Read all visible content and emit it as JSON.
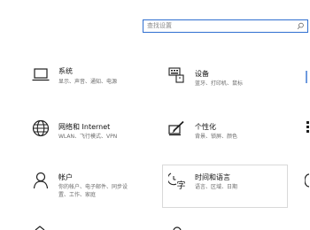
{
  "search": {
    "placeholder": "查找设置"
  },
  "categories": [
    {
      "title": "系统",
      "desc": "显示、声音、通知、电源",
      "icon": "laptop-icon"
    },
    {
      "title": "设备",
      "desc": "蓝牙、打印机、鼠标",
      "icon": "keyboard-icon"
    },
    {
      "title": "网络和 Internet",
      "desc": "WLAN、飞行模式、VPN",
      "icon": "globe-icon"
    },
    {
      "title": "个性化",
      "desc": "背景、锁屏、颜色",
      "icon": "paint-pen-icon"
    },
    {
      "title": "帐户",
      "desc_line1": "你的帐户、电子邮件、同步设",
      "desc_line2": "置、工作、家庭",
      "icon": "person-icon"
    },
    {
      "title": "时间和语言",
      "desc": "语言、区域、日期",
      "icon": "language-clock-icon"
    }
  ],
  "colors": {
    "accent": "#2f6fd0",
    "text": "#111111",
    "secondary_text": "#6c6c6c"
  }
}
